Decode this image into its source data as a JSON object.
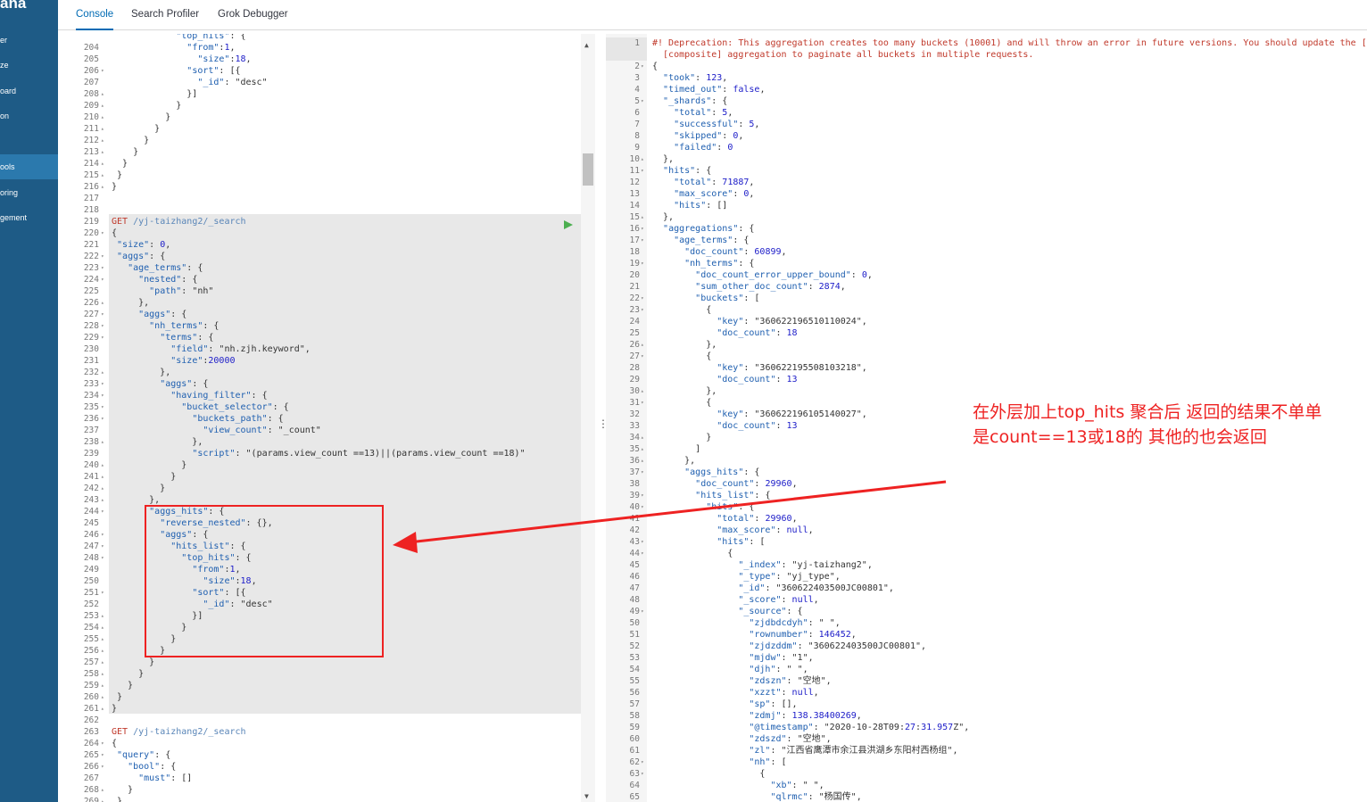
{
  "sidebar": {
    "brand": "ana",
    "items": [
      {
        "label": "er"
      },
      {
        "label": "ze"
      },
      {
        "label": "oard"
      },
      {
        "label": "on"
      },
      {
        "label": "ools"
      },
      {
        "label": "oring"
      },
      {
        "label": "gement"
      }
    ]
  },
  "tabs": [
    {
      "label": "Console",
      "active": true
    },
    {
      "label": "Search Profiler",
      "active": false
    },
    {
      "label": "Grok Debugger",
      "active": false
    }
  ],
  "editor": {
    "lines": [
      {
        "n": "",
        "f": "",
        "indent": 0,
        "t": "            \"top_hits\": {"
      },
      {
        "n": "204",
        "f": "",
        "t": "              \"from\":1,"
      },
      {
        "n": "205",
        "f": "",
        "t": "                \"size\":18,"
      },
      {
        "n": "206",
        "f": "▾",
        "t": "              \"sort\": [{"
      },
      {
        "n": "207",
        "f": "",
        "t": "                \"_id\": \"desc\""
      },
      {
        "n": "208",
        "f": "▴",
        "t": "              }]"
      },
      {
        "n": "209",
        "f": "▴",
        "t": "            }"
      },
      {
        "n": "210",
        "f": "▴",
        "t": "          }"
      },
      {
        "n": "211",
        "f": "▴",
        "t": "        }"
      },
      {
        "n": "212",
        "f": "▴",
        "t": "      }"
      },
      {
        "n": "213",
        "f": "▴",
        "t": "    }"
      },
      {
        "n": "214",
        "f": "▴",
        "t": "  }"
      },
      {
        "n": "215",
        "f": "▴",
        "t": " }"
      },
      {
        "n": "216",
        "f": "▴",
        "t": "}"
      },
      {
        "n": "217",
        "f": "",
        "t": ""
      },
      {
        "n": "218",
        "f": "",
        "t": ""
      },
      {
        "n": "219",
        "f": "",
        "t": "GET /yj-taizhang2/_search"
      },
      {
        "n": "220",
        "f": "▾",
        "t": "{"
      },
      {
        "n": "221",
        "f": "",
        "t": " \"size\": 0,"
      },
      {
        "n": "222",
        "f": "▾",
        "t": " \"aggs\": {"
      },
      {
        "n": "223",
        "f": "▾",
        "t": "   \"age_terms\": {"
      },
      {
        "n": "224",
        "f": "▾",
        "t": "     \"nested\": {"
      },
      {
        "n": "225",
        "f": "",
        "t": "       \"path\": \"nh\""
      },
      {
        "n": "226",
        "f": "▴",
        "t": "     },"
      },
      {
        "n": "227",
        "f": "▾",
        "t": "     \"aggs\": {"
      },
      {
        "n": "228",
        "f": "▾",
        "t": "       \"nh_terms\": {"
      },
      {
        "n": "229",
        "f": "▾",
        "t": "         \"terms\": {"
      },
      {
        "n": "230",
        "f": "",
        "t": "           \"field\": \"nh.zjh.keyword\","
      },
      {
        "n": "231",
        "f": "",
        "t": "           \"size\":20000"
      },
      {
        "n": "232",
        "f": "▴",
        "t": "         },"
      },
      {
        "n": "233",
        "f": "▾",
        "t": "         \"aggs\": {"
      },
      {
        "n": "234",
        "f": "▾",
        "t": "           \"having_filter\": {"
      },
      {
        "n": "235",
        "f": "▾",
        "t": "             \"bucket_selector\": {"
      },
      {
        "n": "236",
        "f": "▾",
        "t": "               \"buckets_path\": {"
      },
      {
        "n": "237",
        "f": "",
        "t": "                 \"view_count\": \"_count\""
      },
      {
        "n": "238",
        "f": "▴",
        "t": "               },"
      },
      {
        "n": "239",
        "f": "",
        "t": "               \"script\": \"(params.view_count ==13)||(params.view_count ==18)\""
      },
      {
        "n": "240",
        "f": "▴",
        "t": "             }"
      },
      {
        "n": "241",
        "f": "▴",
        "t": "           }"
      },
      {
        "n": "242",
        "f": "▴",
        "t": "         }"
      },
      {
        "n": "243",
        "f": "▴",
        "t": "       },"
      },
      {
        "n": "244",
        "f": "▾",
        "t": "       \"aggs_hits\": {"
      },
      {
        "n": "245",
        "f": "",
        "t": "         \"reverse_nested\": {},"
      },
      {
        "n": "246",
        "f": "▾",
        "t": "         \"aggs\": {"
      },
      {
        "n": "247",
        "f": "▾",
        "t": "           \"hits_list\": {"
      },
      {
        "n": "248",
        "f": "▾",
        "t": "             \"top_hits\": {"
      },
      {
        "n": "249",
        "f": "",
        "t": "               \"from\":1,"
      },
      {
        "n": "250",
        "f": "",
        "t": "                 \"size\":18,"
      },
      {
        "n": "251",
        "f": "▾",
        "t": "               \"sort\": [{"
      },
      {
        "n": "252",
        "f": "",
        "t": "                 \"_id\": \"desc\""
      },
      {
        "n": "253",
        "f": "▴",
        "t": "               }]"
      },
      {
        "n": "254",
        "f": "▴",
        "t": "             }"
      },
      {
        "n": "255",
        "f": "▴",
        "t": "           }"
      },
      {
        "n": "256",
        "f": "▴",
        "t": "         }"
      },
      {
        "n": "257",
        "f": "▴",
        "t": "       }"
      },
      {
        "n": "258",
        "f": "▴",
        "t": "     }"
      },
      {
        "n": "259",
        "f": "▴",
        "t": "   }"
      },
      {
        "n": "260",
        "f": "▴",
        "t": " }"
      },
      {
        "n": "261",
        "f": "▴",
        "t": "}"
      },
      {
        "n": "262",
        "f": "",
        "t": ""
      },
      {
        "n": "263",
        "f": "",
        "t": "GET /yj-taizhang2/_search"
      },
      {
        "n": "264",
        "f": "▾",
        "t": "{"
      },
      {
        "n": "265",
        "f": "▾",
        "t": " \"query\": {"
      },
      {
        "n": "266",
        "f": "▾",
        "t": "   \"bool\": {"
      },
      {
        "n": "267",
        "f": "",
        "t": "     \"must\": []"
      },
      {
        "n": "268",
        "f": "▴",
        "t": "   }"
      },
      {
        "n": "269",
        "f": "▴",
        "t": " }"
      }
    ]
  },
  "output": {
    "lines": [
      {
        "n": "1",
        "f": "",
        "t": "#! Deprecation: This aggregation creates too many buckets (10001) and will throw an error in future versions. You should update the [search.max_buckets]",
        "warn": true
      },
      {
        "n": "",
        "f": "",
        "t": "  [composite] aggregation to paginate all buckets in multiple requests.",
        "warn": true
      },
      {
        "n": "2",
        "f": "▾",
        "t": "{"
      },
      {
        "n": "3",
        "f": "",
        "t": "  \"took\": 123,"
      },
      {
        "n": "4",
        "f": "",
        "t": "  \"timed_out\": false,"
      },
      {
        "n": "5",
        "f": "▾",
        "t": "  \"_shards\": {"
      },
      {
        "n": "6",
        "f": "",
        "t": "    \"total\": 5,"
      },
      {
        "n": "7",
        "f": "",
        "t": "    \"successful\": 5,"
      },
      {
        "n": "8",
        "f": "",
        "t": "    \"skipped\": 0,"
      },
      {
        "n": "9",
        "f": "",
        "t": "    \"failed\": 0"
      },
      {
        "n": "10",
        "f": "▴",
        "t": "  },"
      },
      {
        "n": "11",
        "f": "▾",
        "t": "  \"hits\": {"
      },
      {
        "n": "12",
        "f": "",
        "t": "    \"total\": 71887,"
      },
      {
        "n": "13",
        "f": "",
        "t": "    \"max_score\": 0,"
      },
      {
        "n": "14",
        "f": "",
        "t": "    \"hits\": []"
      },
      {
        "n": "15",
        "f": "▴",
        "t": "  },"
      },
      {
        "n": "16",
        "f": "▾",
        "t": "  \"aggregations\": {"
      },
      {
        "n": "17",
        "f": "▾",
        "t": "    \"age_terms\": {"
      },
      {
        "n": "18",
        "f": "",
        "t": "      \"doc_count\": 60899,"
      },
      {
        "n": "19",
        "f": "▾",
        "t": "      \"nh_terms\": {"
      },
      {
        "n": "20",
        "f": "",
        "t": "        \"doc_count_error_upper_bound\": 0,"
      },
      {
        "n": "21",
        "f": "",
        "t": "        \"sum_other_doc_count\": 2874,"
      },
      {
        "n": "22",
        "f": "▾",
        "t": "        \"buckets\": ["
      },
      {
        "n": "23",
        "f": "▾",
        "t": "          {"
      },
      {
        "n": "24",
        "f": "",
        "t": "            \"key\": \"360622196510110024\","
      },
      {
        "n": "25",
        "f": "",
        "t": "            \"doc_count\": 18"
      },
      {
        "n": "26",
        "f": "▴",
        "t": "          },"
      },
      {
        "n": "27",
        "f": "▾",
        "t": "          {"
      },
      {
        "n": "28",
        "f": "",
        "t": "            \"key\": \"360622195508103218\","
      },
      {
        "n": "29",
        "f": "",
        "t": "            \"doc_count\": 13"
      },
      {
        "n": "30",
        "f": "▴",
        "t": "          },"
      },
      {
        "n": "31",
        "f": "▾",
        "t": "          {"
      },
      {
        "n": "32",
        "f": "",
        "t": "            \"key\": \"360622196105140027\","
      },
      {
        "n": "33",
        "f": "",
        "t": "            \"doc_count\": 13"
      },
      {
        "n": "34",
        "f": "▴",
        "t": "          }"
      },
      {
        "n": "35",
        "f": "▴",
        "t": "        ]"
      },
      {
        "n": "36",
        "f": "▴",
        "t": "      },"
      },
      {
        "n": "37",
        "f": "▾",
        "t": "      \"aggs_hits\": {"
      },
      {
        "n": "38",
        "f": "",
        "t": "        \"doc_count\": 29960,"
      },
      {
        "n": "39",
        "f": "▾",
        "t": "        \"hits_list\": {"
      },
      {
        "n": "40",
        "f": "▾",
        "t": "          \"hits\": {"
      },
      {
        "n": "41",
        "f": "",
        "t": "            \"total\": 29960,"
      },
      {
        "n": "42",
        "f": "",
        "t": "            \"max_score\": null,"
      },
      {
        "n": "43",
        "f": "▾",
        "t": "            \"hits\": ["
      },
      {
        "n": "44",
        "f": "▾",
        "t": "              {"
      },
      {
        "n": "45",
        "f": "",
        "t": "                \"_index\": \"yj-taizhang2\","
      },
      {
        "n": "46",
        "f": "",
        "t": "                \"_type\": \"yj_type\","
      },
      {
        "n": "47",
        "f": "",
        "t": "                \"_id\": \"360622403500JC00801\","
      },
      {
        "n": "48",
        "f": "",
        "t": "                \"_score\": null,"
      },
      {
        "n": "49",
        "f": "▾",
        "t": "                \"_source\": {"
      },
      {
        "n": "50",
        "f": "",
        "t": "                  \"zjdbdcdyh\": \" \","
      },
      {
        "n": "51",
        "f": "",
        "t": "                  \"rownumber\": 146452,"
      },
      {
        "n": "52",
        "f": "",
        "t": "                  \"zjdzddm\": \"360622403500JC00801\","
      },
      {
        "n": "53",
        "f": "",
        "t": "                  \"mjdw\": \"1\","
      },
      {
        "n": "54",
        "f": "",
        "t": "                  \"djh\": \" \","
      },
      {
        "n": "55",
        "f": "",
        "t": "                  \"zdszn\": \"空地\","
      },
      {
        "n": "56",
        "f": "",
        "t": "                  \"xzzt\": null,"
      },
      {
        "n": "57",
        "f": "",
        "t": "                  \"sp\": [],"
      },
      {
        "n": "58",
        "f": "",
        "t": "                  \"zdmj\": 138.38400269,"
      },
      {
        "n": "59",
        "f": "",
        "t": "                  \"@timestamp\": \"2020-10-28T09:27:31.957Z\","
      },
      {
        "n": "60",
        "f": "",
        "t": "                  \"zdszd\": \"空地\","
      },
      {
        "n": "61",
        "f": "",
        "t": "                  \"zl\": \"江西省鹰潭市余江县洪湖乡东阳村西杨组\","
      },
      {
        "n": "62",
        "f": "▾",
        "t": "                  \"nh\": ["
      },
      {
        "n": "63",
        "f": "▾",
        "t": "                    {"
      },
      {
        "n": "64",
        "f": "",
        "t": "                      \"xb\": \" \","
      },
      {
        "n": "65",
        "f": "",
        "t": "                      \"qlrmc\": \"杨国传\","
      }
    ]
  },
  "annotation": {
    "line1": "在外层加上top_hits 聚合后 返回的结果不单单",
    "line2": "是count==13或18的  其他的也会返回"
  },
  "colors": {
    "sidebar": "#1e5b86",
    "sidebar_active": "#2b79ad",
    "tab_active": "#006bb4",
    "annotation": "#e22222",
    "request_highlight": "#e8e8e8"
  },
  "icons": [
    "play-icon",
    "wrench-icon",
    "scroll-up-icon",
    "scroll-down-icon",
    "panel-resize-grip-icon"
  ]
}
